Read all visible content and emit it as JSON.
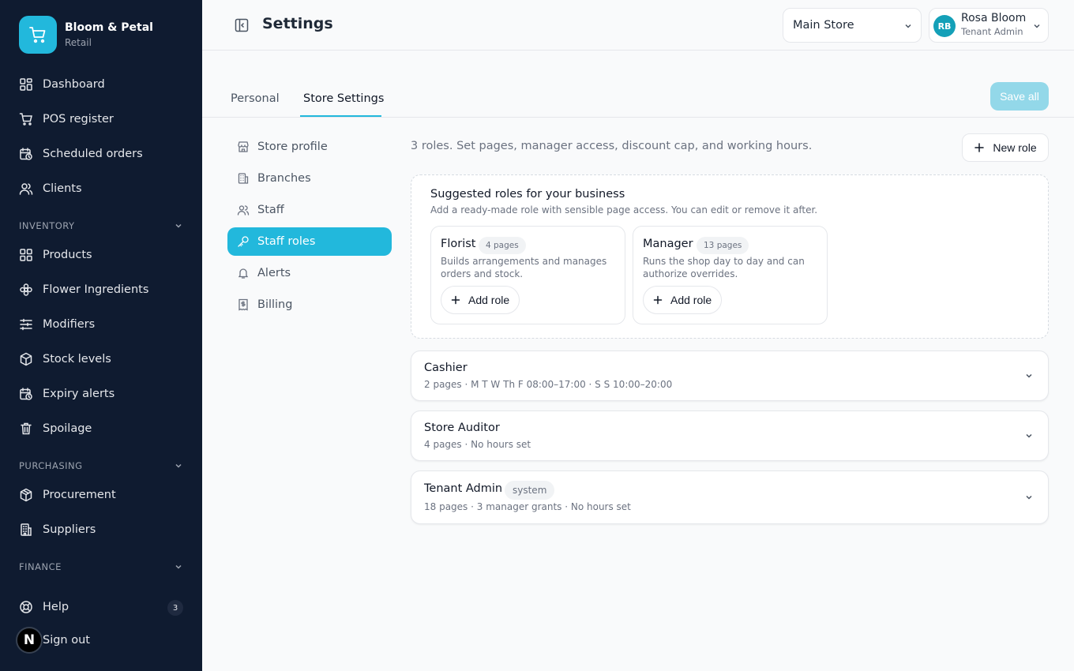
{
  "brand": {
    "name": "Bloom & Petal",
    "subtitle": "Retail"
  },
  "sidebar": {
    "items": [
      {
        "label": "Dashboard",
        "icon": "dashboard-icon"
      },
      {
        "label": "POS register",
        "icon": "cart-icon"
      },
      {
        "label": "Scheduled orders",
        "icon": "calendar-clock-icon"
      },
      {
        "label": "Clients",
        "icon": "users-icon"
      }
    ],
    "inventory": {
      "heading": "INVENTORY",
      "items": [
        {
          "label": "Products",
          "icon": "grid-icon"
        },
        {
          "label": "Flower Ingredients",
          "icon": "flower-icon"
        },
        {
          "label": "Modifiers",
          "icon": "sliders-icon"
        },
        {
          "label": "Stock levels",
          "icon": "box-icon"
        },
        {
          "label": "Expiry alerts",
          "icon": "calendar-clock-icon"
        },
        {
          "label": "Spoilage",
          "icon": "trash-icon"
        }
      ]
    },
    "purchasing": {
      "heading": "PURCHASING",
      "items": [
        {
          "label": "Procurement",
          "icon": "package-icon"
        },
        {
          "label": "Suppliers",
          "icon": "building-icon"
        }
      ]
    },
    "finance": {
      "heading": "FINANCE"
    },
    "help": {
      "label": "Help",
      "badge": "3"
    },
    "signout": {
      "label": "Sign out"
    },
    "n_badge": "N"
  },
  "header": {
    "title": "Settings",
    "store": "Main Store",
    "user": {
      "initials": "RB",
      "name": "Rosa Bloom",
      "role": "Tenant Admin"
    }
  },
  "tabs": [
    {
      "label": "Personal"
    },
    {
      "label": "Store Settings"
    }
  ],
  "save_all": "Save all",
  "subnav": [
    {
      "label": "Store profile",
      "icon": "store-icon"
    },
    {
      "label": "Branches",
      "icon": "building-icon"
    },
    {
      "label": "Staff",
      "icon": "users-icon"
    },
    {
      "label": "Staff roles",
      "icon": "key-icon"
    },
    {
      "label": "Alerts",
      "icon": "bell-icon"
    },
    {
      "label": "Billing",
      "icon": "receipt-icon"
    }
  ],
  "main": {
    "intro": "3 roles. Set pages, manager access, discount cap, and working hours.",
    "new_role": "New role",
    "suggested": {
      "title": "Suggested roles for your business",
      "subtitle": "Add a ready-made role with sensible page access. You can edit or remove it after.",
      "cards": [
        {
          "name": "Florist",
          "pages": "4 pages",
          "desc": "Builds arrangements and manages orders and stock.",
          "button": "Add role"
        },
        {
          "name": "Manager",
          "pages": "13 pages",
          "desc": "Runs the shop day to day and can authorize overrides.",
          "button": "Add role"
        }
      ]
    },
    "roles": [
      {
        "name": "Cashier",
        "meta": "2 pages · M T W Th F 08:00–17:00 · S S 10:00–20:00"
      },
      {
        "name": "Store Auditor",
        "meta": "4 pages · No hours set"
      },
      {
        "name": "Tenant Admin",
        "tag": "system",
        "meta": "18 pages · 3 manager grants · No hours set"
      }
    ]
  },
  "colors": {
    "sidebar_bg": "#0f1b30",
    "accent": "#22b8dc"
  }
}
